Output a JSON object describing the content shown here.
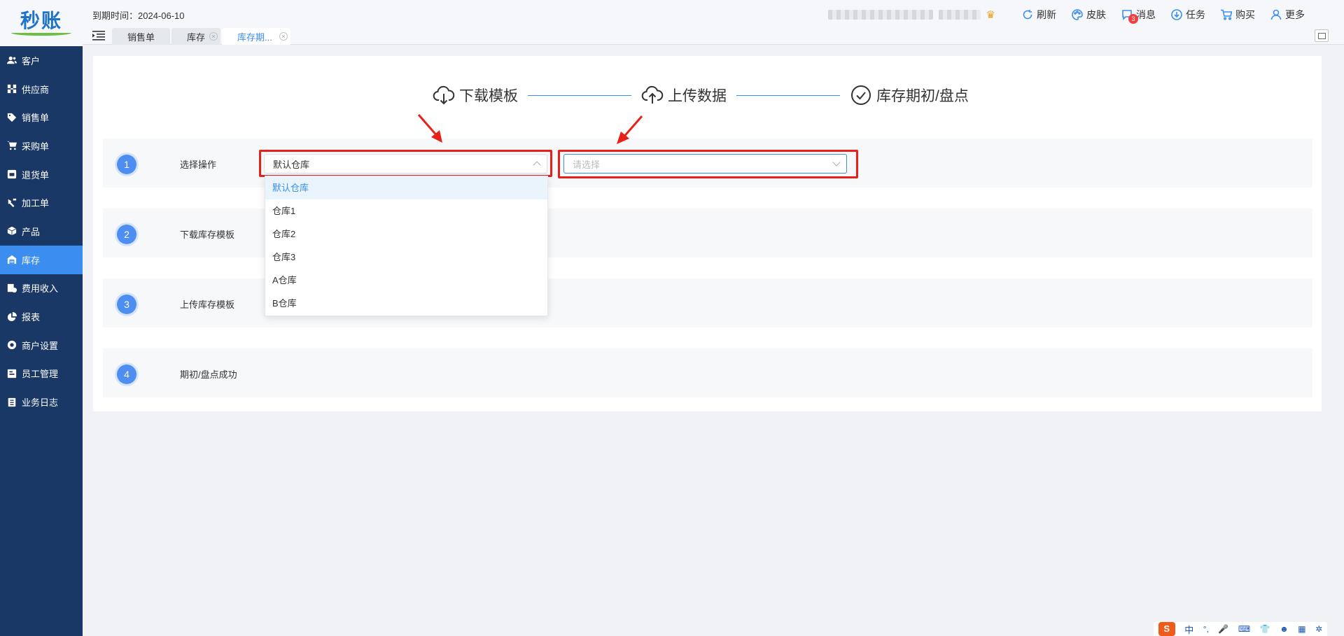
{
  "app": {
    "logo_text": "秒账"
  },
  "sidebar": {
    "items": [
      {
        "label": "客户",
        "icon": "users-icon"
      },
      {
        "label": "供应商",
        "icon": "supplier-icon"
      },
      {
        "label": "销售单",
        "icon": "tag-icon"
      },
      {
        "label": "采购单",
        "icon": "cart-icon"
      },
      {
        "label": "退货单",
        "icon": "return-icon"
      },
      {
        "label": "加工单",
        "icon": "wrench-icon"
      },
      {
        "label": "产品",
        "icon": "box-icon"
      },
      {
        "label": "库存",
        "icon": "warehouse-icon",
        "active": true
      },
      {
        "label": "费用收入",
        "icon": "finance-icon"
      },
      {
        "label": "报表",
        "icon": "pie-chart-icon"
      },
      {
        "label": "商户设置",
        "icon": "gear-icon"
      },
      {
        "label": "员工管理",
        "icon": "staff-icon"
      },
      {
        "label": "业务日志",
        "icon": "log-icon"
      }
    ]
  },
  "topbar": {
    "expire_label": "到期时间：2024-06-10",
    "tabs": [
      {
        "label": "销售单",
        "closable": false
      },
      {
        "label": "库存",
        "closable": true
      },
      {
        "label": "库存期...",
        "closable": true,
        "active": true
      }
    ],
    "actions": {
      "refresh": "刷新",
      "skin": "皮肤",
      "messages": "消息",
      "messages_badge": "3",
      "tasks": "任务",
      "buy": "购买",
      "more": "更多"
    }
  },
  "steps": {
    "download": "下载模板",
    "upload": "上传数据",
    "done": "库存期初/盘点"
  },
  "rows": [
    {
      "num": "1",
      "label": "选择操作"
    },
    {
      "num": "2",
      "label": "下载库存模板"
    },
    {
      "num": "3",
      "label": "上传库存模板"
    },
    {
      "num": "4",
      "label": "期初/盘点成功"
    }
  ],
  "warehouse_select": {
    "value": "默认仓库",
    "options": [
      "默认仓库",
      "仓库1",
      "仓库2",
      "仓库3",
      "A仓库",
      "B仓库"
    ]
  },
  "operation_select": {
    "placeholder": "请选择"
  },
  "colors": {
    "sidebar": "#1a3866",
    "accent": "#3b8ef0",
    "highlight": "#e8201a"
  },
  "ime": {
    "lang": "中",
    "punct": "°,",
    "logo": "S"
  }
}
